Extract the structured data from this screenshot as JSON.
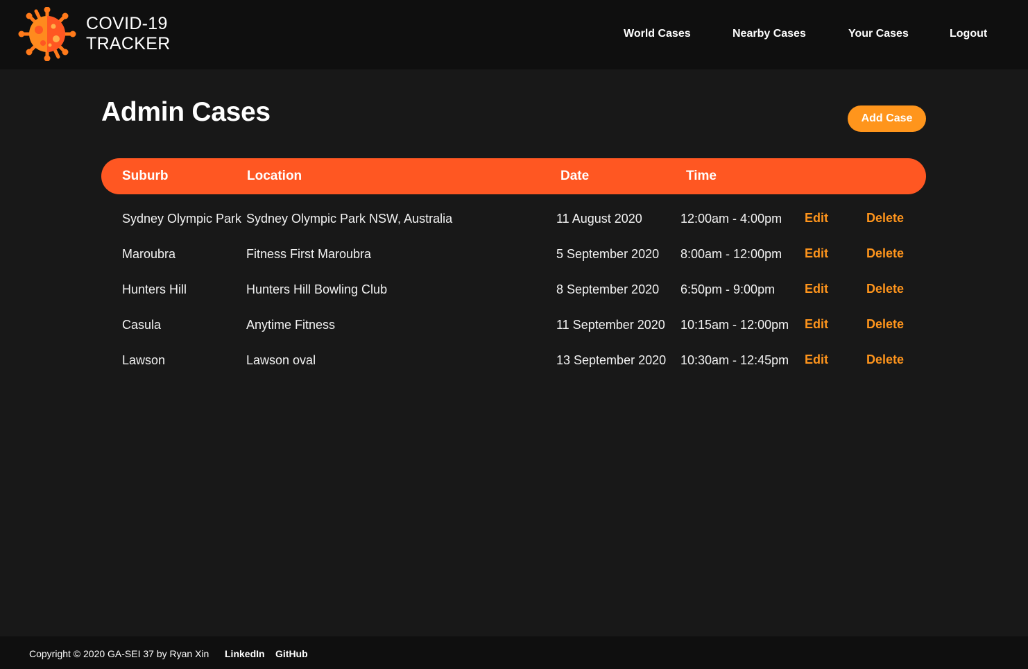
{
  "header": {
    "brand_line1": "COVID-19",
    "brand_line2": "TRACKER",
    "logo_icon": "virus-icon",
    "nav": [
      {
        "label": "World Cases"
      },
      {
        "label": "Nearby Cases"
      },
      {
        "label": "Your Cases"
      },
      {
        "label": "Logout"
      }
    ]
  },
  "main": {
    "title": "Admin Cases",
    "add_button_label": "Add Case",
    "table": {
      "columns": [
        "Suburb",
        "Location",
        "Date",
        "Time"
      ],
      "rows": [
        {
          "suburb": "Sydney Olympic Park",
          "location": "Sydney Olympic Park NSW, Australia",
          "date": "11 August 2020",
          "time": "12:00am - 4:00pm",
          "edit": "Edit",
          "delete": "Delete"
        },
        {
          "suburb": "Maroubra",
          "location": "Fitness First Maroubra",
          "date": "5 September 2020",
          "time": "8:00am - 12:00pm",
          "edit": "Edit",
          "delete": "Delete"
        },
        {
          "suburb": "Hunters Hill",
          "location": "Hunters Hill Bowling Club",
          "date": "8 September 2020",
          "time": "6:50pm - 9:00pm",
          "edit": "Edit",
          "delete": "Delete"
        },
        {
          "suburb": "Casula",
          "location": "Anytime Fitness",
          "date": "11 September 2020",
          "time": "10:15am - 12:00pm",
          "edit": "Edit",
          "delete": "Delete"
        },
        {
          "suburb": "Lawson",
          "location": "Lawson oval",
          "date": "13 September 2020",
          "time": "10:30am - 12:45pm",
          "edit": "Edit",
          "delete": "Delete"
        }
      ]
    }
  },
  "footer": {
    "copyright": "Copyright © 2020 GA-SEI 37 by Ryan Xin",
    "links": [
      {
        "label": "LinkedIn"
      },
      {
        "label": "GitHub"
      }
    ]
  },
  "colors": {
    "background": "#181818",
    "navbar": "#0f0f0f",
    "accent_header": "#ff5722",
    "accent_action": "#ff951c"
  }
}
